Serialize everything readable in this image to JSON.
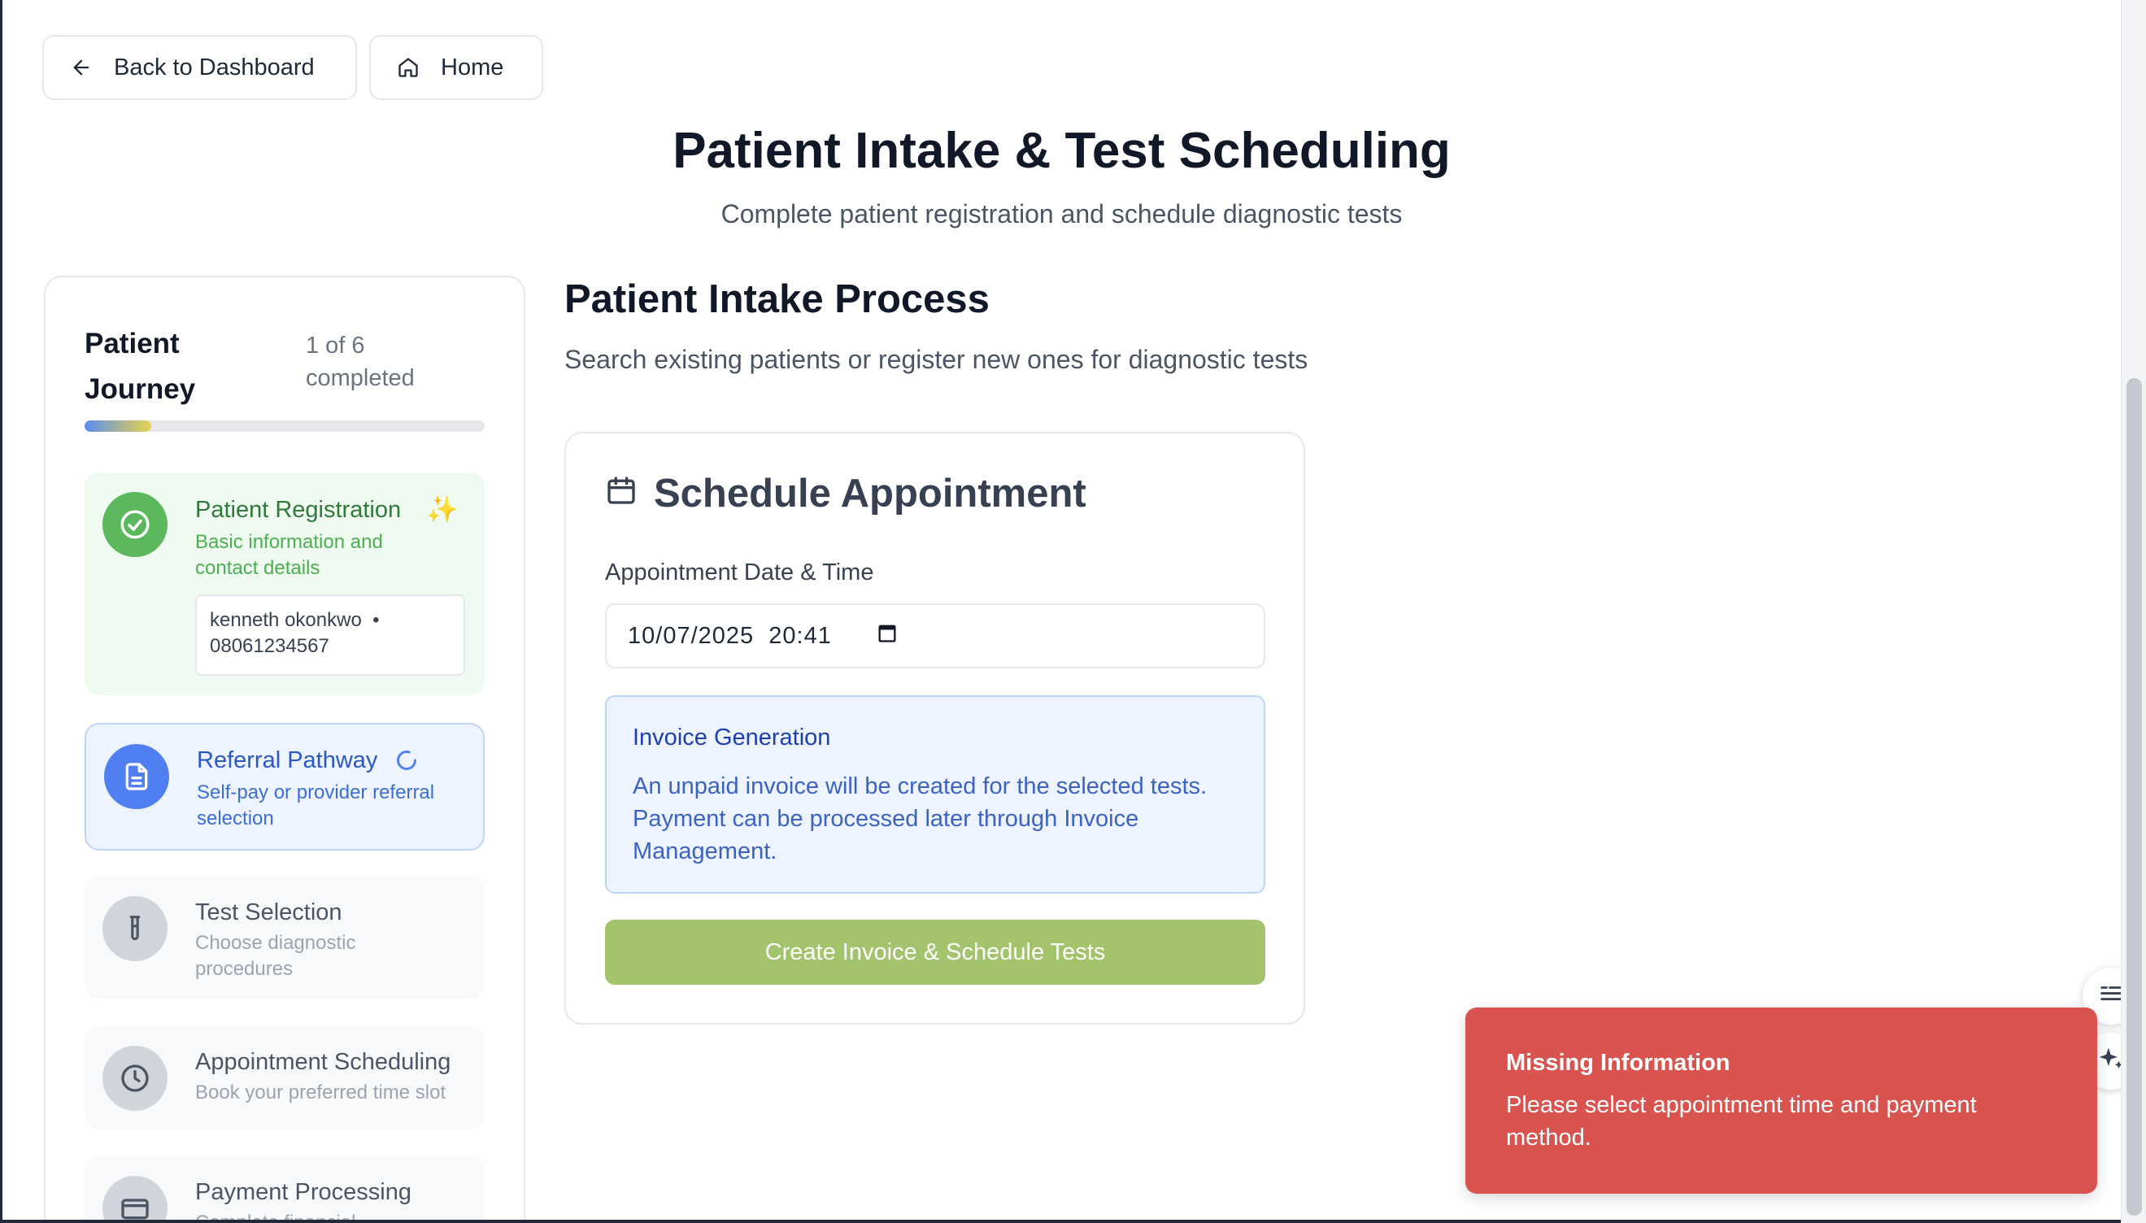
{
  "nav": {
    "back_label": "Back to Dashboard",
    "home_label": "Home"
  },
  "header": {
    "title": "Patient Intake & Test Scheduling",
    "subtitle": "Complete patient registration and schedule diagnostic tests"
  },
  "sidebar": {
    "title": "Patient Journey",
    "count": "1 of 6 completed",
    "progress_fraction": 0.167,
    "steps": [
      {
        "title": "Patient Registration",
        "desc": "Basic information and contact details",
        "status": "completed",
        "icon": "check-circle-icon"
      },
      {
        "title": "Referral Pathway",
        "desc": "Self-pay or provider referral selection",
        "status": "in-progress",
        "icon": "document-icon"
      },
      {
        "title": "Test Selection",
        "desc": "Choose diagnostic procedures",
        "status": "pending",
        "icon": "test-tube-icon"
      },
      {
        "title": "Appointment Scheduling",
        "desc": "Book your preferred time slot",
        "status": "pending",
        "icon": "clock-icon"
      },
      {
        "title": "Payment Processing",
        "desc": "Complete financial",
        "status": "pending",
        "icon": "credit-card-icon"
      }
    ],
    "patient_summary": {
      "name": "kenneth okonkwo",
      "separator": "•",
      "phone": "08061234567"
    }
  },
  "main": {
    "title": "Patient Intake Process",
    "subtitle": "Search existing patients or register new ones for diagnostic tests",
    "card": {
      "title": "Schedule Appointment",
      "field_label": "Appointment Date & Time",
      "date_value": "10/07/2025",
      "time_value": "20:41",
      "info_title": "Invoice Generation",
      "info_text": "An unpaid invoice will be created for the selected tests. Payment can be processed later through Invoice Management.",
      "submit_label": "Create Invoice & Schedule Tests"
    }
  },
  "toast": {
    "title": "Missing Information",
    "message": "Please select appointment time and payment method."
  },
  "colors": {
    "success": "#5cb85c",
    "primary": "#4f7ff0",
    "submit": "#a3c46c",
    "error": "#d9534f"
  }
}
